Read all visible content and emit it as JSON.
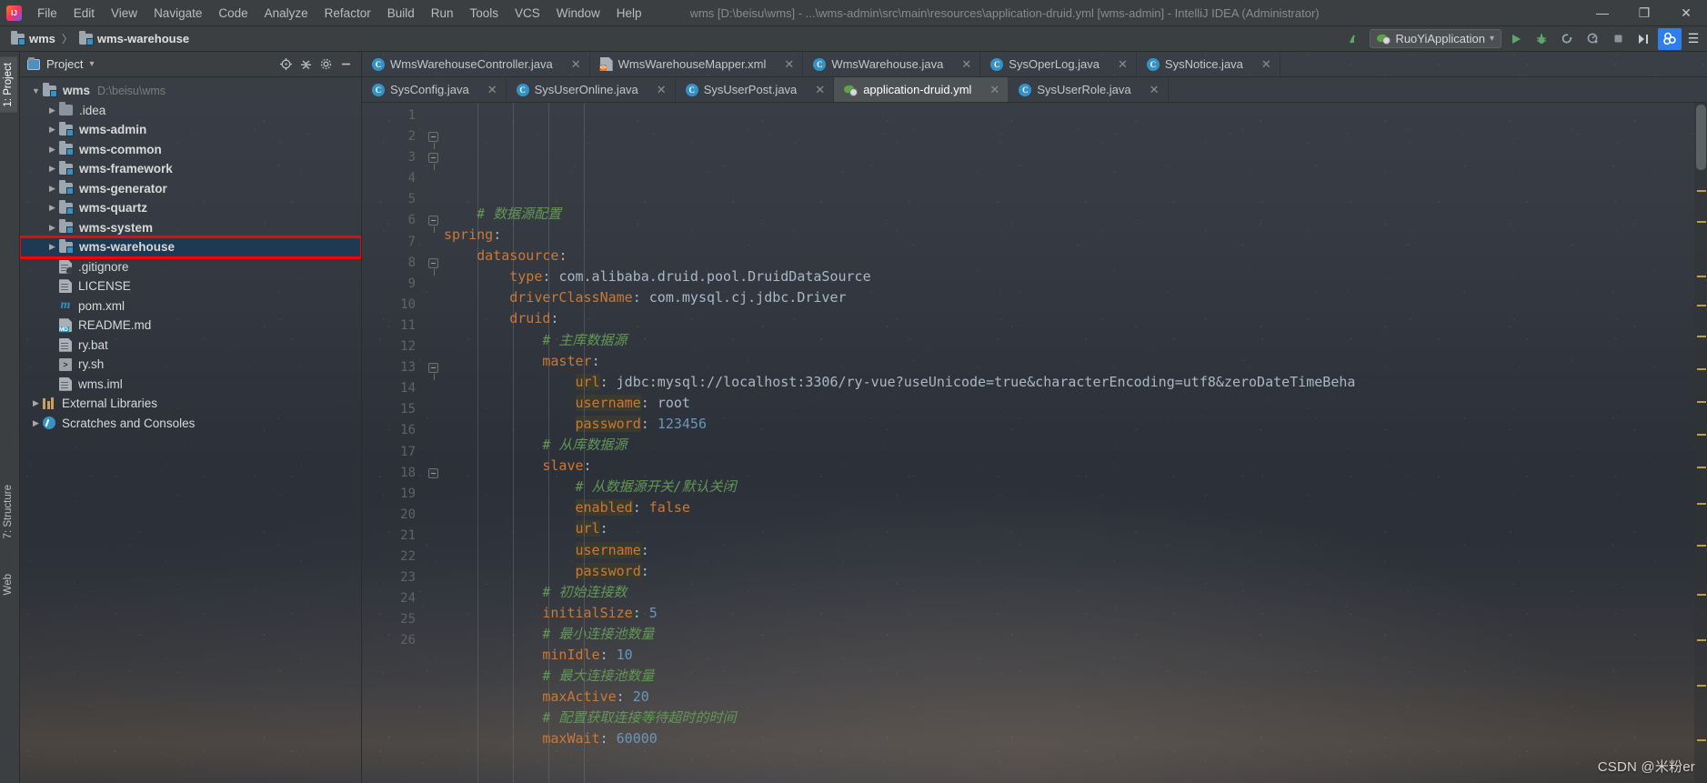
{
  "window": {
    "title": "wms [D:\\beisu\\wms] - ...\\wms-admin\\src\\main\\resources\\application-druid.yml [wms-admin] - IntelliJ IDEA (Administrator)",
    "minimize_label": "—",
    "maximize_label": "❐",
    "close_label": "✕",
    "logo_name": "intellij-idea-logo"
  },
  "menu": {
    "items": [
      {
        "label": "File"
      },
      {
        "label": "Edit"
      },
      {
        "label": "View"
      },
      {
        "label": "Navigate"
      },
      {
        "label": "Code"
      },
      {
        "label": "Analyze"
      },
      {
        "label": "Refactor"
      },
      {
        "label": "Build"
      },
      {
        "label": "Run"
      },
      {
        "label": "Tools"
      },
      {
        "label": "VCS"
      },
      {
        "label": "Window"
      },
      {
        "label": "Help"
      }
    ]
  },
  "navbar": {
    "breadcrumbs": [
      {
        "label": "wms"
      },
      {
        "label": "wms-warehouse"
      }
    ],
    "separator": "〉",
    "run_configuration": "RuoYiApplication",
    "dropdown_arrow": "▾",
    "buttons": [
      {
        "name": "updates-icon",
        "glyph": "↖"
      },
      {
        "name": "run-button",
        "glyph": "▶"
      },
      {
        "name": "debug-button",
        "glyph": "ὁE"
      },
      {
        "name": "run-coverage-button",
        "glyph": "⟳"
      },
      {
        "name": "profiler-button",
        "glyph": "◔"
      },
      {
        "name": "stop-button",
        "glyph": "■"
      },
      {
        "name": "attach-button",
        "glyph": "▶|"
      },
      {
        "name": "search-everywhere-icon",
        "glyph": "⌕"
      }
    ]
  },
  "rail": {
    "project_tab": "1: Project",
    "structure_tab": "7: Structure",
    "web_tab": "Web"
  },
  "project_panel": {
    "title": "Project",
    "dropdown_arrow": "▾",
    "actions": [
      {
        "name": "locate-in-tree-icon",
        "glyph": "⊕"
      },
      {
        "name": "collapse-all-icon",
        "glyph": "⨍"
      },
      {
        "name": "settings-gear-icon",
        "glyph": "⚙"
      },
      {
        "name": "hide-panel-icon",
        "glyph": "−"
      }
    ],
    "tree": [
      {
        "label": "wms",
        "path": "D:\\beisu\\wms",
        "icon": "module-folder-icon",
        "indent": 0,
        "arrow": "expanded",
        "bold": true
      },
      {
        "label": ".idea",
        "icon": "folder-icon",
        "indent": 1,
        "arrow": "collapsed",
        "bold": false
      },
      {
        "label": "wms-admin",
        "icon": "module-folder-icon",
        "indent": 1,
        "arrow": "collapsed",
        "bold": true
      },
      {
        "label": "wms-common",
        "icon": "module-folder-icon",
        "indent": 1,
        "arrow": "collapsed",
        "bold": true
      },
      {
        "label": "wms-framework",
        "icon": "module-folder-icon",
        "indent": 1,
        "arrow": "collapsed",
        "bold": true
      },
      {
        "label": "wms-generator",
        "icon": "module-folder-icon",
        "indent": 1,
        "arrow": "collapsed",
        "bold": true
      },
      {
        "label": "wms-quartz",
        "icon": "module-folder-icon",
        "indent": 1,
        "arrow": "collapsed",
        "bold": true
      },
      {
        "label": "wms-system",
        "icon": "module-folder-icon",
        "indent": 1,
        "arrow": "collapsed",
        "bold": true
      },
      {
        "label": "wms-warehouse",
        "icon": "module-folder-icon",
        "indent": 1,
        "arrow": "collapsed",
        "bold": true,
        "selected": true,
        "highlighted": true
      },
      {
        "label": ".gitignore",
        "icon": "gitignore-file-icon",
        "indent": 1,
        "arrow": "none",
        "bold": false
      },
      {
        "label": "LICENSE",
        "icon": "text-file-icon",
        "indent": 1,
        "arrow": "none",
        "bold": false
      },
      {
        "label": "pom.xml",
        "icon": "maven-file-icon",
        "indent": 1,
        "arrow": "none",
        "bold": false
      },
      {
        "label": "README.md",
        "icon": "markdown-file-icon",
        "indent": 1,
        "arrow": "none",
        "bold": false
      },
      {
        "label": "ry.bat",
        "icon": "text-file-icon",
        "indent": 1,
        "arrow": "none",
        "bold": false
      },
      {
        "label": "ry.sh",
        "icon": "shell-file-icon",
        "indent": 1,
        "arrow": "none",
        "bold": false
      },
      {
        "label": "wms.iml",
        "icon": "text-file-icon",
        "indent": 1,
        "arrow": "none",
        "bold": false
      },
      {
        "label": "External Libraries",
        "icon": "library-icon",
        "indent": 0,
        "arrow": "collapsed",
        "bold": false
      },
      {
        "label": "Scratches and Consoles",
        "icon": "scratches-icon",
        "indent": 0,
        "arrow": "collapsed",
        "bold": false
      }
    ]
  },
  "editor": {
    "tab_rows": [
      [
        {
          "label": "WmsWarehouseController.java",
          "icon": "java-class-icon",
          "active": false,
          "close": "✕"
        },
        {
          "label": "WmsWarehouseMapper.xml",
          "icon": "xml-file-icon",
          "active": false,
          "close": "✕"
        },
        {
          "label": "WmsWarehouse.java",
          "icon": "java-class-icon",
          "active": false,
          "close": "✕"
        },
        {
          "label": "SysOperLog.java",
          "icon": "java-class-icon",
          "active": false,
          "close": "✕"
        },
        {
          "label": "SysNotice.java",
          "icon": "java-class-icon",
          "active": false,
          "close": "✕"
        }
      ],
      [
        {
          "label": "SysConfig.java",
          "icon": "java-class-icon",
          "active": false,
          "close": "✕"
        },
        {
          "label": "SysUserOnline.java",
          "icon": "java-class-icon",
          "active": false,
          "close": "✕"
        },
        {
          "label": "SysUserPost.java",
          "icon": "java-class-icon",
          "active": false,
          "close": "✕"
        },
        {
          "label": "application-druid.yml",
          "icon": "yaml-file-icon",
          "active": true,
          "close": "✕"
        },
        {
          "label": "SysUserRole.java",
          "icon": "java-class-icon",
          "active": false,
          "close": "✕"
        }
      ]
    ],
    "filename": "application-druid.yml",
    "first_line": 1,
    "line_numbers": [
      1,
      2,
      3,
      4,
      5,
      6,
      7,
      8,
      9,
      10,
      11,
      12,
      13,
      14,
      15,
      16,
      17,
      18,
      19,
      20,
      21,
      22,
      23,
      24,
      25,
      26
    ],
    "code_lines": [
      {
        "n": 1,
        "indent": 1,
        "tokens": [
          {
            "t": "# 数据源配置",
            "c": "cmt"
          }
        ]
      },
      {
        "n": 2,
        "indent": 0,
        "fold": "open",
        "tokens": [
          {
            "t": "spring",
            "c": "key"
          },
          {
            "t": ":",
            "c": "txt"
          }
        ]
      },
      {
        "n": 3,
        "indent": 1,
        "fold": "open",
        "tokens": [
          {
            "t": "datasource",
            "c": "key"
          },
          {
            "t": ":",
            "c": "txt"
          }
        ]
      },
      {
        "n": 4,
        "indent": 2,
        "tokens": [
          {
            "t": "type",
            "c": "key"
          },
          {
            "t": ": ",
            "c": "txt"
          },
          {
            "t": "com.alibaba.druid.pool.DruidDataSource",
            "c": "val"
          }
        ]
      },
      {
        "n": 5,
        "indent": 2,
        "tokens": [
          {
            "t": "driverClassName",
            "c": "key"
          },
          {
            "t": ": ",
            "c": "txt"
          },
          {
            "t": "com.mysql.cj.jdbc.Driver",
            "c": "val"
          }
        ]
      },
      {
        "n": 6,
        "indent": 2,
        "fold": "open",
        "tokens": [
          {
            "t": "druid",
            "c": "key"
          },
          {
            "t": ":",
            "c": "txt"
          }
        ]
      },
      {
        "n": 7,
        "indent": 3,
        "tokens": [
          {
            "t": "# 主库数据源",
            "c": "cmt"
          }
        ]
      },
      {
        "n": 8,
        "indent": 3,
        "fold": "open",
        "tokens": [
          {
            "t": "master",
            "c": "key"
          },
          {
            "t": ":",
            "c": "txt"
          }
        ]
      },
      {
        "n": 9,
        "indent": 4,
        "tokens": [
          {
            "t": "url",
            "c": "key hl"
          },
          {
            "t": ": ",
            "c": "txt"
          },
          {
            "t": "jdbc:mysql://localhost:3306/ry-vue?useUnicode=true&characterEncoding=utf8&zeroDateTimeBeha",
            "c": "val"
          }
        ]
      },
      {
        "n": 10,
        "indent": 4,
        "tokens": [
          {
            "t": "username",
            "c": "key hl"
          },
          {
            "t": ": ",
            "c": "txt"
          },
          {
            "t": "root",
            "c": "val"
          }
        ]
      },
      {
        "n": 11,
        "indent": 4,
        "tokens": [
          {
            "t": "password",
            "c": "key hl"
          },
          {
            "t": ": ",
            "c": "txt"
          },
          {
            "t": "123456",
            "c": "num"
          }
        ]
      },
      {
        "n": 12,
        "indent": 3,
        "tokens": [
          {
            "t": "# 从库数据源",
            "c": "cmt"
          }
        ]
      },
      {
        "n": 13,
        "indent": 3,
        "fold": "open",
        "tokens": [
          {
            "t": "slave",
            "c": "key"
          },
          {
            "t": ":",
            "c": "txt"
          }
        ]
      },
      {
        "n": 14,
        "indent": 4,
        "tokens": [
          {
            "t": "# 从数据源开关/默认关闭",
            "c": "cmt"
          }
        ]
      },
      {
        "n": 15,
        "indent": 4,
        "tokens": [
          {
            "t": "enabled",
            "c": "key hl"
          },
          {
            "t": ": ",
            "c": "txt"
          },
          {
            "t": "false",
            "c": "key"
          }
        ]
      },
      {
        "n": 16,
        "indent": 4,
        "tokens": [
          {
            "t": "url",
            "c": "key hl"
          },
          {
            "t": ":",
            "c": "txt"
          }
        ]
      },
      {
        "n": 17,
        "indent": 4,
        "tokens": [
          {
            "t": "username",
            "c": "key hl"
          },
          {
            "t": ":",
            "c": "txt"
          }
        ]
      },
      {
        "n": 18,
        "indent": 4,
        "fold": "tip",
        "tokens": [
          {
            "t": "password",
            "c": "key hl"
          },
          {
            "t": ":",
            "c": "txt"
          }
        ]
      },
      {
        "n": 19,
        "indent": 3,
        "tokens": [
          {
            "t": "# 初始连接数",
            "c": "cmt"
          }
        ]
      },
      {
        "n": 20,
        "indent": 3,
        "tokens": [
          {
            "t": "initialSize",
            "c": "key"
          },
          {
            "t": ": ",
            "c": "txt"
          },
          {
            "t": "5",
            "c": "num"
          }
        ]
      },
      {
        "n": 21,
        "indent": 3,
        "tokens": [
          {
            "t": "# 最小连接池数量",
            "c": "cmt"
          }
        ]
      },
      {
        "n": 22,
        "indent": 3,
        "tokens": [
          {
            "t": "minIdle",
            "c": "key"
          },
          {
            "t": ": ",
            "c": "txt"
          },
          {
            "t": "10",
            "c": "num"
          }
        ]
      },
      {
        "n": 23,
        "indent": 3,
        "tokens": [
          {
            "t": "# 最大连接池数量",
            "c": "cmt"
          }
        ]
      },
      {
        "n": 24,
        "indent": 3,
        "tokens": [
          {
            "t": "maxActive",
            "c": "key"
          },
          {
            "t": ": ",
            "c": "txt"
          },
          {
            "t": "20",
            "c": "num"
          }
        ]
      },
      {
        "n": 25,
        "indent": 3,
        "tokens": [
          {
            "t": "# 配置获取连接等待超时的时间",
            "c": "cmt"
          }
        ]
      },
      {
        "n": 26,
        "indent": 3,
        "tokens": [
          {
            "t": "maxWait",
            "c": "key"
          },
          {
            "t": ": ",
            "c": "txt"
          },
          {
            "t": "60000",
            "c": "num"
          }
        ]
      }
    ]
  },
  "watermark": {
    "text": "CSDN @米粉er"
  },
  "colors": {
    "accent_blue": "#3592c4",
    "selection_blue": "#1d3a52",
    "highlight_red": "#ff0000",
    "comment_green": "#629755",
    "keyword_orange": "#cc7832",
    "number_blue": "#6897bb",
    "text_grey": "#a9b7c6",
    "panel_bg": "#3c3f41",
    "tab_active_bg": "#4e5254"
  }
}
